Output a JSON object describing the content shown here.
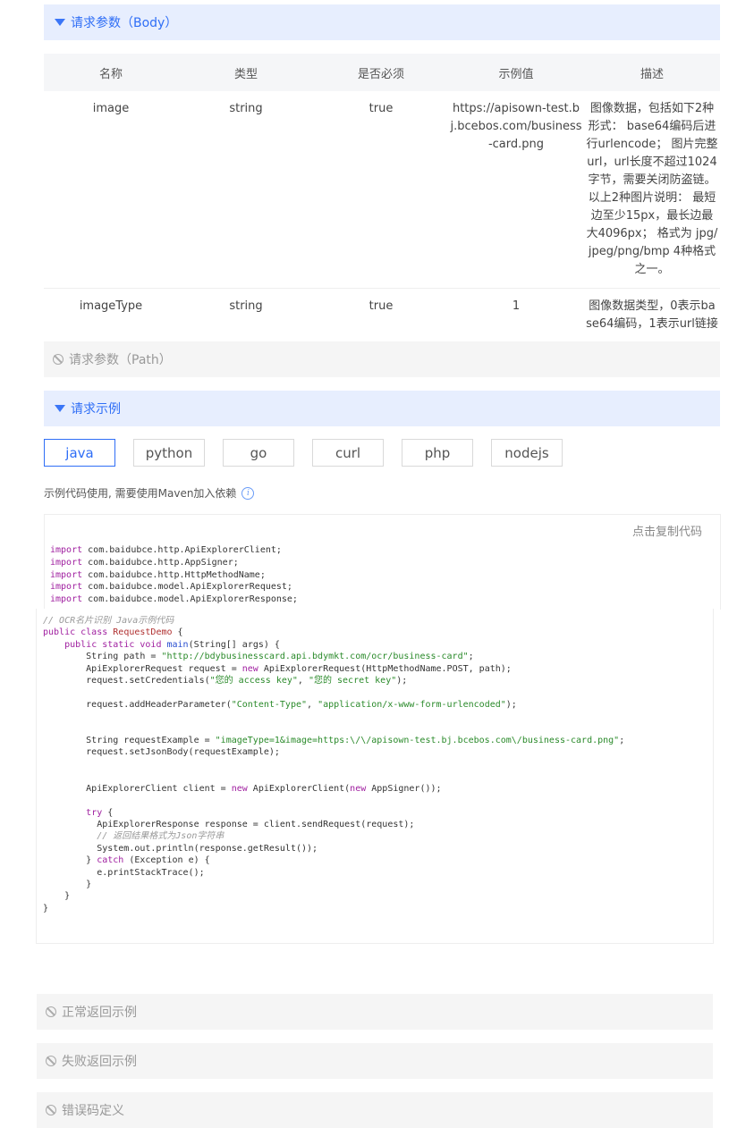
{
  "sections": {
    "body_params": "请求参数（Body）",
    "path_params": "请求参数（Path）",
    "request_example": "请求示例",
    "normal_response": "正常返回示例",
    "fail_response": "失败返回示例",
    "error_codes": "错误码定义"
  },
  "table": {
    "headers": [
      "名称",
      "类型",
      "是否必须",
      "示例值",
      "描述"
    ],
    "rows": [
      [
        "image",
        "string",
        "true",
        "https://apisown-test.bj.bcebos.com/business-card.png",
        "图像数据，包括如下2种形式： base64编码后进行urlencode； 图片完整url，url长度不超过1024字节，需要关闭防盗链。 以上2种图片说明： 最短边至少15px，最长边最大4096px； 格式为 jpg/jpeg/png/bmp 4种格式之一。"
      ],
      [
        "imageType",
        "string",
        "true",
        "1",
        "图像数据类型，0表示base64编码，1表示url链接"
      ]
    ]
  },
  "tabs": [
    "java",
    "python",
    "go",
    "curl",
    "php",
    "nodejs"
  ],
  "active_tab": "java",
  "note": "示例代码使用, 需要使用Maven加入依赖",
  "copy_label": "点击复制代码",
  "imports": [
    "com.baidubce.http.ApiExplorerClient;",
    "com.baidubce.http.AppSigner;",
    "com.baidubce.http.HttpMethodName;",
    "com.baidubce.model.ApiExplorerRequest;",
    "com.baidubce.model.ApiExplorerResponse;"
  ],
  "code": {
    "comment_title": "// OCR名片识别 Java示例代码",
    "class_name": "RequestDemo",
    "path_url": "\"http://bdybusinesscard.api.bdymkt.com/ocr/business-card\"",
    "access_key": "\"您的 access key\"",
    "secret_key": "\"您的 secret key\"",
    "header_name": "\"Content-Type\"",
    "header_value": "\"application/x-www-form-urlencoded\"",
    "request_example": "\"imageType=1&image=https:\\/\\/apisown-test.bj.bcebos.com\\/business-card.png\"",
    "comment_result": "// 返回结果格式为Json字符串"
  }
}
